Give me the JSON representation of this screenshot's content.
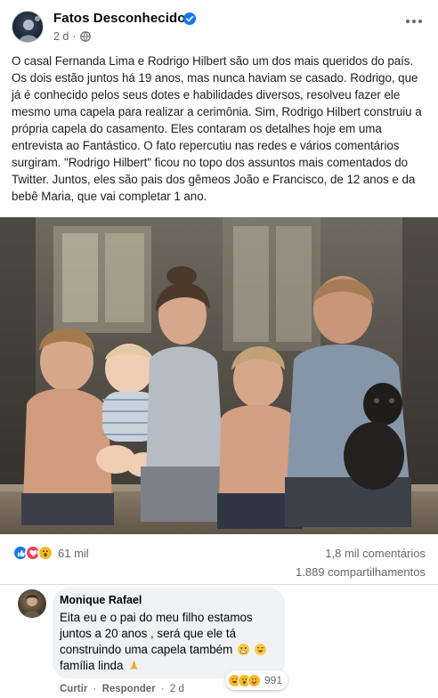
{
  "post": {
    "page_name": "Fatos Desconhecidos",
    "time": "2 d",
    "separator": "·",
    "text": "O casal Fernanda Lima e Rodrigo Hilbert são um dos mais queridos do país. Os dois estão juntos há 19 anos, mas nunca haviam se casado. Rodrigo, que já é conhecido pelos seus dotes e habilidades diversos, resolveu fazer ele mesmo uma capela para realizar a cerimônia. Sim, Rodrigo Hilbert construiu a própria capela do casamento. Eles contaram os detalhes hoje em uma entrevista ao Fantástico. O fato repercutiu nas redes e vários comentários surgiram. \"Rodrigo Hilbert\" ficou no topo dos assuntos mais comentados do Twitter. Juntos, eles são pais dos gêmeos João e Francisco, de 12 anos e da bebê Maria, que vai completar 1 ano.",
    "icons": {
      "verified": "verified-badge-icon",
      "privacy": "globe-icon",
      "menu": "more-horizontal-icon"
    }
  },
  "stats": {
    "reactions": "61 mil",
    "reaction_icons": [
      "like",
      "love",
      "wow"
    ],
    "comments": "1,8 mil comentários",
    "shares": "1.889 compartilhamentos"
  },
  "comment": {
    "author": "Monique Rafael",
    "text": "Eita eu e o pai do meu filho estamos juntos a 20 anos , será que ele tá construindo uma capela também",
    "text_tail": "família linda",
    "reaction_count": "991",
    "actions": {
      "like": "Curtir",
      "reply": "Responder",
      "time": "2 d",
      "separator": "·"
    }
  },
  "colors": {
    "brand_blue": "#1877f2",
    "love_red": "#f33e58",
    "wow_yellow": "#f7b928",
    "secondary_text": "#65676b",
    "bubble_bg": "#f0f2f5"
  }
}
